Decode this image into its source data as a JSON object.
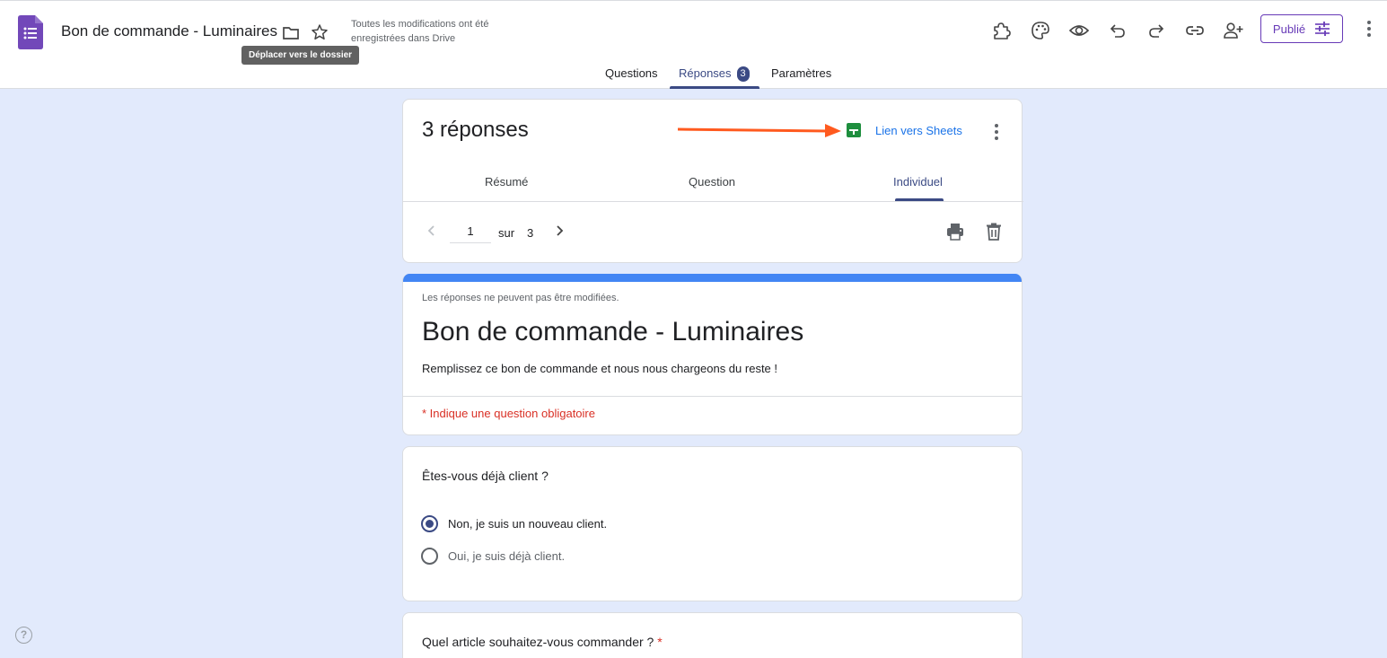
{
  "header": {
    "title": "Bon de commande - Luminaires",
    "save_status": "Toutes les modifications ont été enregistrées dans Drive",
    "tooltip": "Déplacer vers le dossier",
    "publish_label": "Publié",
    "toolbar_icons": [
      "addon-puzzle-icon",
      "palette-icon",
      "preview-eye-icon",
      "undo-icon",
      "redo-icon",
      "link-icon",
      "add-collaborator-icon"
    ]
  },
  "tabs": [
    {
      "label": "Questions"
    },
    {
      "label": "Réponses",
      "badge": "3",
      "active": true
    },
    {
      "label": "Paramètres"
    }
  ],
  "summary": {
    "count_label": "3 réponses",
    "sheets_link": "Lien vers Sheets",
    "subtabs": [
      {
        "label": "Résumé"
      },
      {
        "label": "Question"
      },
      {
        "label": "Individuel",
        "active": true
      }
    ],
    "pager": {
      "current": "1",
      "sur": "sur",
      "total": "3"
    }
  },
  "form": {
    "no_edit_note": "Les réponses ne peuvent pas être modifiées.",
    "title": "Bon de commande - Luminaires",
    "description": "Remplissez ce bon de commande et nous nous chargeons du reste !",
    "required_note": "* Indique une question obligatoire"
  },
  "question1": {
    "title": "Êtes-vous déjà client ?",
    "options": [
      {
        "label": "Non, je suis un nouveau client.",
        "selected": true
      },
      {
        "label": "Oui, je suis déjà client.",
        "selected": false
      }
    ]
  },
  "question2": {
    "title": "Quel article souhaitez-vous commander ?",
    "required_mark": "*"
  },
  "help": {
    "symbol": "?"
  },
  "colors": {
    "brand": "#673ab7",
    "accent": "#3b4a84",
    "sheets_green": "#1e8e3e",
    "link_blue": "#1a73e8",
    "required_red": "#d93025",
    "arrow_orange": "#ff5a1f",
    "background": "#e2eafc"
  }
}
